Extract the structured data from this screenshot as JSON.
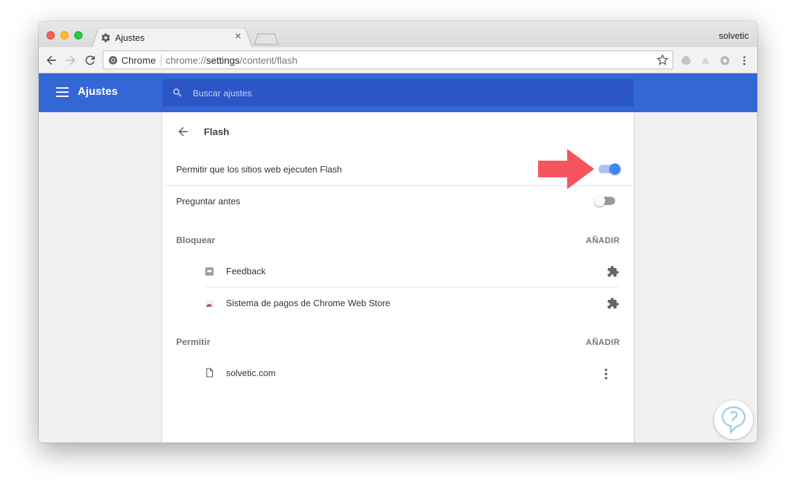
{
  "window": {
    "tab_title": "Ajustes",
    "profile_name": "solvetic"
  },
  "toolbar": {
    "site_name": "Chrome",
    "url_scheme": "chrome://",
    "url_host": "settings",
    "url_path": "/content/flash"
  },
  "header": {
    "title": "Ajustes",
    "search_placeholder": "Buscar ajustes"
  },
  "page": {
    "title": "Flash",
    "allow_flash": {
      "label": "Permitir que los sitios web ejecuten Flash",
      "enabled": true
    },
    "ask_first": {
      "label": "Preguntar antes",
      "enabled": false
    }
  },
  "block": {
    "title": "Bloquear",
    "add_label": "AÑADIR",
    "items": [
      {
        "label": "Feedback",
        "icon": "feedback-icon"
      },
      {
        "label": "Sistema de pagos de Chrome Web Store",
        "icon": "chrome-web-store-icon"
      }
    ]
  },
  "allow": {
    "title": "Permitir",
    "add_label": "AÑADIR",
    "items": [
      {
        "label": "solvetic.com",
        "icon": "file-icon"
      }
    ]
  },
  "colors": {
    "header_blue": "#3367d6",
    "search_blue": "#2a56c6",
    "toggle_on": "#4285f4",
    "annotation_arrow": "#f6545c"
  }
}
